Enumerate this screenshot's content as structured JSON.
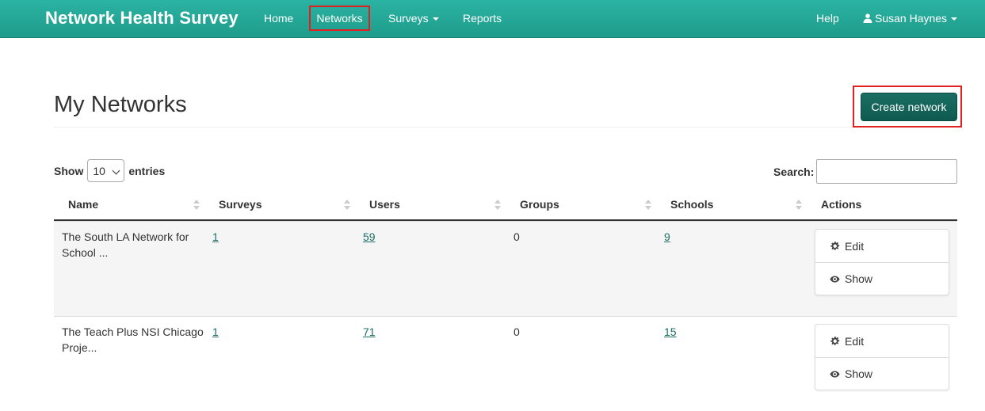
{
  "navbar": {
    "brand": "Network Health Survey",
    "items": [
      {
        "label": "Home"
      },
      {
        "label": "Networks"
      },
      {
        "label": "Surveys"
      },
      {
        "label": "Reports"
      }
    ],
    "help": "Help",
    "user": "Susan Haynes"
  },
  "page": {
    "title": "My Networks",
    "create_button": "Create network"
  },
  "controls": {
    "show_label": "Show",
    "entries_value": "10",
    "entries_label": "entries",
    "search_label": "Search:",
    "search_value": ""
  },
  "table": {
    "columns": [
      "Name",
      "Surveys",
      "Users",
      "Groups",
      "Schools",
      "Actions"
    ],
    "rows": [
      {
        "name": "The South LA Network for School ...",
        "surveys": "1",
        "users": "59",
        "groups": "0",
        "schools": "9",
        "edit": "Edit",
        "show": "Show"
      },
      {
        "name": "The Teach Plus NSI Chicago Proje...",
        "surveys": "1",
        "users": "71",
        "groups": "0",
        "schools": "15",
        "edit": "Edit",
        "show": "Show"
      }
    ]
  },
  "colors": {
    "navbar": "#22a999",
    "primary_button": "#135f55",
    "link": "#1b6e63",
    "highlight": "#e0201e"
  },
  "icons": {
    "user": "user-icon",
    "edit": "gear-icon",
    "show": "eye-icon",
    "dropdown": "caret-down-icon",
    "sort": "sort-icon"
  }
}
